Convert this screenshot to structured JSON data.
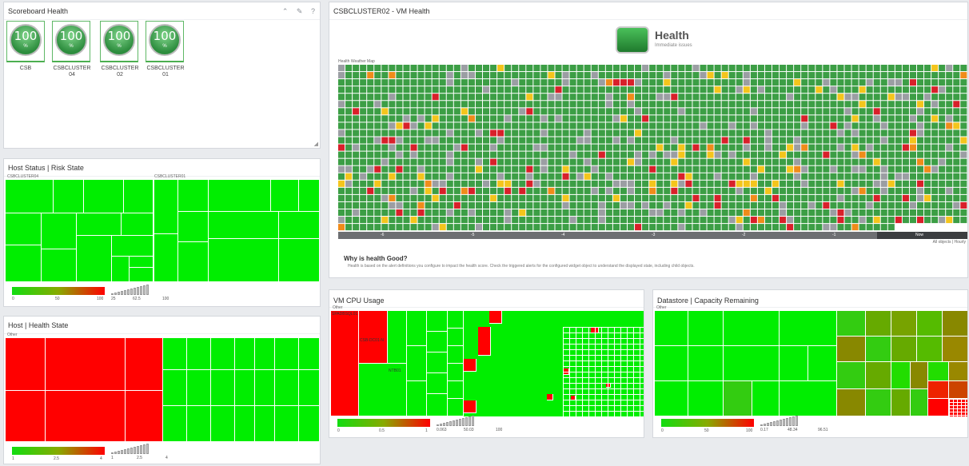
{
  "scoreboard": {
    "title": "Scoreboard Health",
    "gauges": [
      {
        "value": "100",
        "unit": "%",
        "label": "CSB"
      },
      {
        "value": "100",
        "unit": "%",
        "label": "CSBCLUSTER 04"
      },
      {
        "value": "100",
        "unit": "%",
        "label": "CSBCLUSTER 02"
      },
      {
        "value": "100",
        "unit": "%",
        "label": "CSBCLUSTER 01"
      }
    ]
  },
  "host_risk": {
    "title": "Host Status | Risk State",
    "group_left": "CSBCLUSTER04",
    "group_right": "CSBCLUSTER01",
    "legend": {
      "color_ticks": [
        "0",
        "50",
        "100"
      ],
      "size_ticks": [
        "25",
        "62.5",
        "100"
      ]
    }
  },
  "host_health": {
    "title": "Host | Health State",
    "group": "Other",
    "legend": {
      "color_ticks": [
        "1",
        "2.5",
        "4"
      ],
      "size_ticks": [
        "1",
        "2.5",
        "4"
      ]
    }
  },
  "vm_health": {
    "title": "CSBCLUSTER02 - VM Health",
    "badge_title": "Health",
    "badge_subtitle": "Immediate issues",
    "map_title": "Health Weather Map",
    "axis_labels": [
      "-6",
      "-5",
      "-4",
      "-3",
      "-2",
      "-1",
      "Now"
    ],
    "footer_right": "All objects | Hourly",
    "why_title": "Why is health Good?",
    "why_text": "Health is based on the alert definitions you configure to impact the health score. Check the triggered alerts for the configured widget object to understand the displayed state, including child objects.",
    "colors": {
      "green": "#3c9e45",
      "gray": "#9b9ea3",
      "yellow": "#f4c51c",
      "orange": "#f08c1a",
      "red": "#d8202a"
    }
  },
  "vm_cpu": {
    "title": "VM CPU Usage",
    "group": "Other",
    "labels": [
      "SPADBSQL01",
      "CSB-DC01-N",
      "NTB01"
    ],
    "legend": {
      "color_ticks": [
        "0",
        "0.5",
        "1"
      ],
      "size_ticks": [
        "0.063",
        "50.03",
        "100"
      ]
    }
  },
  "datastore": {
    "title": "Datastore | Capacity Remaining",
    "group": "Other",
    "legend": {
      "color_ticks": [
        "0",
        "50",
        "100"
      ],
      "size_ticks": [
        "0.17",
        "48.34",
        "96.51"
      ]
    }
  }
}
